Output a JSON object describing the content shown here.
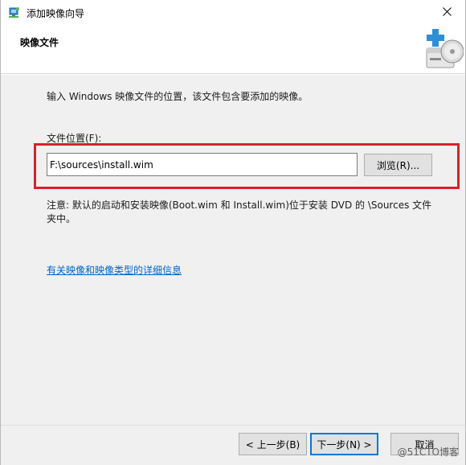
{
  "window": {
    "title": "添加映像向导",
    "icon": "wds-wizard-icon"
  },
  "header": {
    "title": "映像文件",
    "art_icon": "add-disk-image-icon"
  },
  "content": {
    "intro": "输入 Windows 映像文件的位置，该文件包含要添加的映像。",
    "field_label": "文件位置(F):",
    "path_value": "F:\\sources\\install.wim",
    "browse_label": "浏览(R)...",
    "note": "注意: 默认的启动和安装映像(Boot.wim 和 Install.wim)位于安装 DVD 的 \\Sources 文件夹中。",
    "link": "有关映像和映像类型的详细信息"
  },
  "footer": {
    "back_label": "< 上一步(B)",
    "next_label": "下一步(N) >",
    "cancel_label": "取消"
  },
  "watermark": "@51CTO博客",
  "colors": {
    "highlight": "#d4242b",
    "link": "#0066cc",
    "default_button_border": "#0078d7"
  }
}
